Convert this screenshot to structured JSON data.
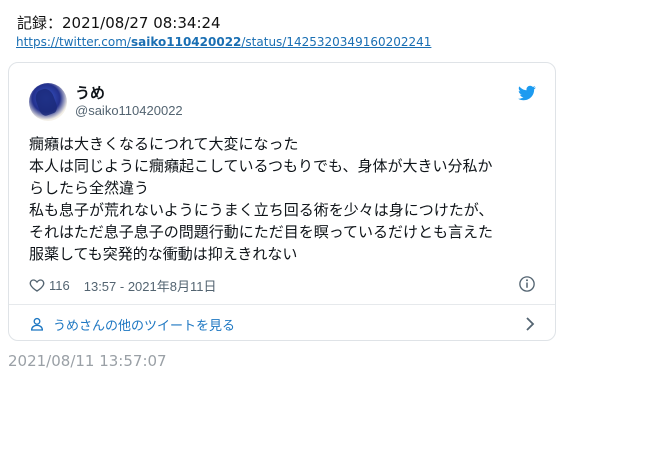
{
  "record": {
    "text": "記録：2021/08/27 08:34:24"
  },
  "source_url": {
    "prefix": "https://twitter.com/",
    "user": "saiko110420022",
    "suffix": "/status/1425320349160202241"
  },
  "tweet": {
    "display_name": "うめ",
    "handle": "@saiko110420022",
    "lines": [
      "癇癪は大きくなるにつれて大変になった",
      "本人は同じように癇癪起こしているつもりでも、身体が大きい分私か",
      "らしたら全然違う",
      "私も息子が荒れないようにうまく立ち回る術を少々は身につけたが、",
      "それはただ息子息子の問題行動にただ目を瞑っているだけとも言えた",
      "服薬しても突発的な衝動は抑えきれない"
    ],
    "like_count": "116",
    "time_date": "13:57 - 2021年8月11日",
    "more_tweets_label": "うめさんの他のツイートを見る"
  },
  "footer_timestamp": "2021/08/11 13:57:07",
  "colors": {
    "link": "#1a6fb3",
    "twitter_blue": "#1d9bf0",
    "muted": "#536471"
  },
  "icons": [
    "twitter-bird-icon",
    "heart-icon",
    "info-icon",
    "person-icon",
    "chevron-right-icon"
  ]
}
